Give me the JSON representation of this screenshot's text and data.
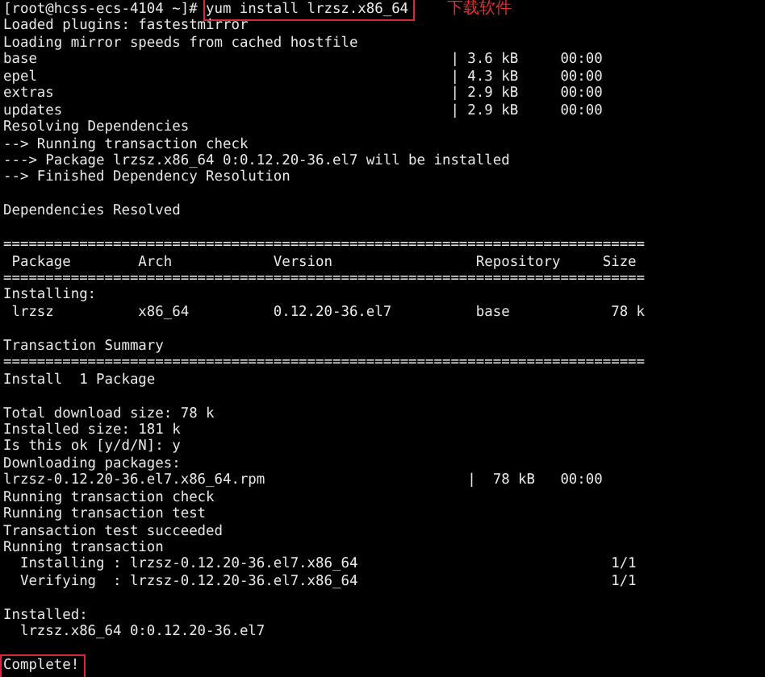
{
  "terminal": {
    "lines": [
      {
        "kind": "prompt",
        "prompt": "[root@hcss-ecs-4104 ~]#",
        "command": "yum install lrzsz.x86_64",
        "boxed": true,
        "annotation": "下载软件"
      },
      {
        "kind": "text",
        "text": "Loaded plugins: fastestmirror",
        "boxed": false
      },
      {
        "kind": "text",
        "text": "Loading mirror speeds from cached hostfile",
        "boxed": false
      },
      {
        "kind": "text",
        "text": "base                                                 | 3.6 kB     00:00",
        "boxed": false
      },
      {
        "kind": "text",
        "text": "epel                                                 | 4.3 kB     00:00",
        "boxed": false
      },
      {
        "kind": "text",
        "text": "extras                                               | 2.9 kB     00:00",
        "boxed": false
      },
      {
        "kind": "text",
        "text": "updates                                              | 2.9 kB     00:00",
        "boxed": false
      },
      {
        "kind": "text",
        "text": "Resolving Dependencies",
        "boxed": false
      },
      {
        "kind": "text",
        "text": "--> Running transaction check",
        "boxed": false
      },
      {
        "kind": "text",
        "text": "---> Package lrzsz.x86_64 0:0.12.20-36.el7 will be installed",
        "boxed": false
      },
      {
        "kind": "text",
        "text": "--> Finished Dependency Resolution",
        "boxed": false
      },
      {
        "kind": "blank"
      },
      {
        "kind": "text",
        "text": "Dependencies Resolved",
        "boxed": false
      },
      {
        "kind": "blank"
      },
      {
        "kind": "text",
        "text": "============================================================================",
        "boxed": false
      },
      {
        "kind": "text",
        "text": " Package        Arch            Version                 Repository     Size",
        "boxed": false
      },
      {
        "kind": "text",
        "text": "============================================================================",
        "boxed": false
      },
      {
        "kind": "text",
        "text": "Installing:",
        "boxed": false
      },
      {
        "kind": "text",
        "text": " lrzsz          x86_64          0.12.20-36.el7          base            78 k",
        "boxed": false
      },
      {
        "kind": "blank"
      },
      {
        "kind": "text",
        "text": "Transaction Summary",
        "boxed": false
      },
      {
        "kind": "text",
        "text": "============================================================================",
        "boxed": false
      },
      {
        "kind": "text",
        "text": "Install  1 Package",
        "boxed": false
      },
      {
        "kind": "blank"
      },
      {
        "kind": "text",
        "text": "Total download size: 78 k",
        "boxed": false
      },
      {
        "kind": "text",
        "text": "Installed size: 181 k",
        "boxed": false
      },
      {
        "kind": "text",
        "text": "Is this ok [y/d/N]: y",
        "boxed": false
      },
      {
        "kind": "text",
        "text": "Downloading packages:",
        "boxed": false
      },
      {
        "kind": "text",
        "text": "lrzsz-0.12.20-36.el7.x86_64.rpm                        |  78 kB   00:00",
        "boxed": false
      },
      {
        "kind": "text",
        "text": "Running transaction check",
        "boxed": false
      },
      {
        "kind": "text",
        "text": "Running transaction test",
        "boxed": false
      },
      {
        "kind": "text",
        "text": "Transaction test succeeded",
        "boxed": false
      },
      {
        "kind": "text",
        "text": "Running transaction",
        "boxed": false
      },
      {
        "kind": "text",
        "text": "  Installing : lrzsz-0.12.20-36.el7.x86_64                              1/1",
        "boxed": false
      },
      {
        "kind": "text",
        "text": "  Verifying  : lrzsz-0.12.20-36.el7.x86_64                              1/1",
        "boxed": false
      },
      {
        "kind": "blank"
      },
      {
        "kind": "text",
        "text": "Installed:",
        "boxed": false
      },
      {
        "kind": "text",
        "text": "  lrzsz.x86_64 0:0.12.20-36.el7",
        "boxed": false
      },
      {
        "kind": "blank"
      },
      {
        "kind": "text",
        "text": "Complete!",
        "boxed": true
      }
    ]
  }
}
